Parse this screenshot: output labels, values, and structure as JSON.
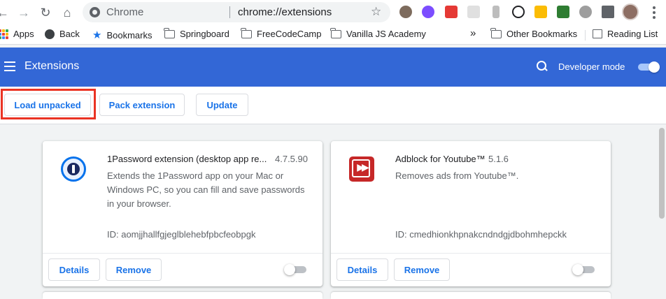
{
  "browser": {
    "omnibox": {
      "label": "Chrome",
      "url": "chrome://extensions"
    }
  },
  "bookmarks": [
    {
      "label": "Apps",
      "icon": "apps-grid-icon"
    },
    {
      "label": "Back",
      "icon": "globe-icon"
    },
    {
      "label": "Bookmarks",
      "icon": "star-icon"
    },
    {
      "label": "Springboard",
      "icon": "folder-icon"
    },
    {
      "label": "FreeCodeCamp",
      "icon": "folder-icon"
    },
    {
      "label": "Vanilla JS Academy",
      "icon": "folder-icon"
    }
  ],
  "bookmarks_overflow": "»",
  "other_bookmarks": "Other Bookmarks",
  "reading_list": "Reading List",
  "header": {
    "title": "Extensions",
    "developer_mode_label": "Developer mode",
    "developer_mode_on": true,
    "color": "#3367d6"
  },
  "actions": {
    "load_unpacked": "Load unpacked",
    "pack_extension": "Pack extension",
    "update": "Update",
    "highlight_color": "#ea3323"
  },
  "extensions": [
    {
      "name": "1Password extension (desktop app re...",
      "version": "4.7.5.90",
      "description": "Extends the 1Password app on your Mac or Windows PC, so you can fill and save passwords in your browser.",
      "id": "ID: aomjjhallfgjeglblehebfpbcfeobpgk",
      "details_label": "Details",
      "remove_label": "Remove",
      "enabled": false,
      "icon": "onepassword-icon"
    },
    {
      "name": "Adblock for Youtube™",
      "version": "5.1.6",
      "description": "Removes ads from Youtube™.",
      "id": "ID: cmedhionkhpnakcndndgjdbohmhepckk",
      "details_label": "Details",
      "remove_label": "Remove",
      "enabled": false,
      "icon": "adblock-icon"
    }
  ]
}
